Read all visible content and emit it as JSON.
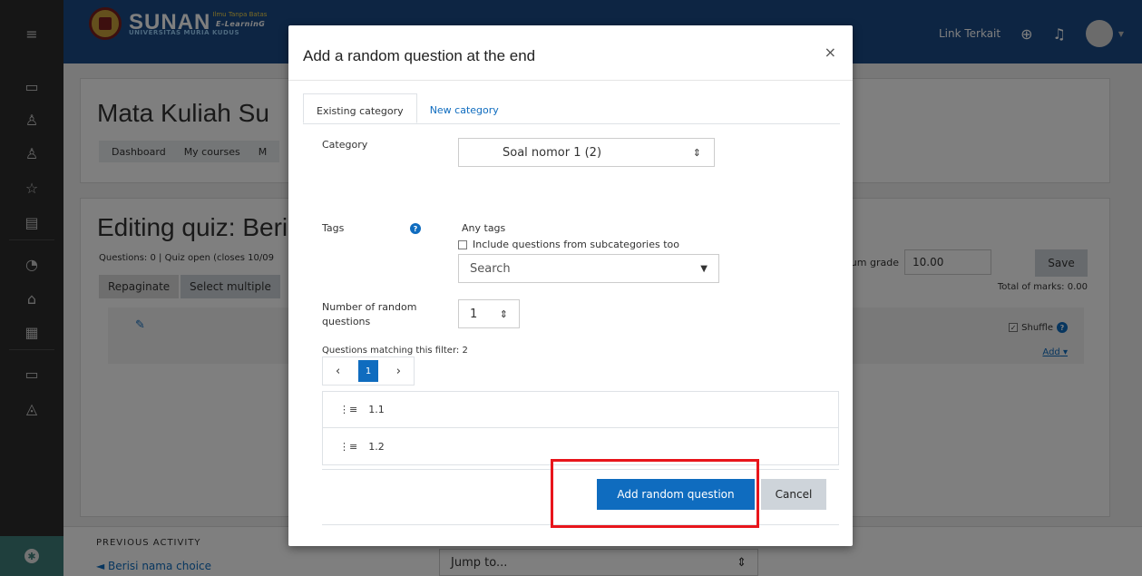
{
  "brand": {
    "name": "SUNAN",
    "tagline": "Ilmu Tanpa Batas",
    "product": "E-LearninG",
    "university": "UNIVERSITAS MURIA KUDUS"
  },
  "navbar": {
    "link_label": "Link Terkait"
  },
  "rail": {
    "icons": [
      "hamburger-icon",
      "folder-icon",
      "users-icon",
      "user-group-icon",
      "star-icon",
      "book-icon",
      "dashboard-icon",
      "home-icon",
      "calendar-icon",
      "folder-icon",
      "graduation-cap-icon"
    ]
  },
  "page": {
    "title": "Mata Kuliah Su",
    "breadcrumb": [
      "Dashboard",
      "My courses",
      "M"
    ],
    "quiz_title": "Editing quiz: Beri",
    "quiz_meta": "Questions: 0 | Quiz open (closes 10/09",
    "repaginate": "Repaginate",
    "select_multiple": "Select multiple",
    "max_grade_label": "Maximum grade",
    "max_grade_value": "10.00",
    "save": "Save",
    "total_marks": "Total of marks: 0.00",
    "shuffle": "Shuffle",
    "shuffle_checked": true,
    "add": "Add"
  },
  "footer": {
    "previous_label": "PREVIOUS ACTIVITY",
    "previous_link": "◄ Berisi nama choice",
    "jump_to": "Jump to..."
  },
  "modal": {
    "title": "Add a random question at the end",
    "close": "×",
    "tabs": [
      {
        "label": "Existing category",
        "active": true
      },
      {
        "label": "New category",
        "active": false
      }
    ],
    "category_label": "Category",
    "category_value": "Soal nomor 1 (2)",
    "include_subcategories": "Include questions from subcategories too",
    "include_subcategories_checked": false,
    "tags_label": "Tags",
    "tags_value": "Any tags",
    "tags_search_placeholder": "Search",
    "num_random_label": "Number of random questions",
    "num_random_value": "1",
    "matching": "Questions matching this filter: 2",
    "pager": {
      "prev": "‹",
      "current": "1",
      "next": "›"
    },
    "questions": [
      {
        "name": "1.1"
      },
      {
        "name": "1.2"
      }
    ],
    "add_button": "Add random question",
    "cancel_button": "Cancel"
  },
  "colors": {
    "primary": "#0f6cbf",
    "navbar": "#1b4b86",
    "rail": "#2d2d2d",
    "highlight": "#e8151b"
  }
}
